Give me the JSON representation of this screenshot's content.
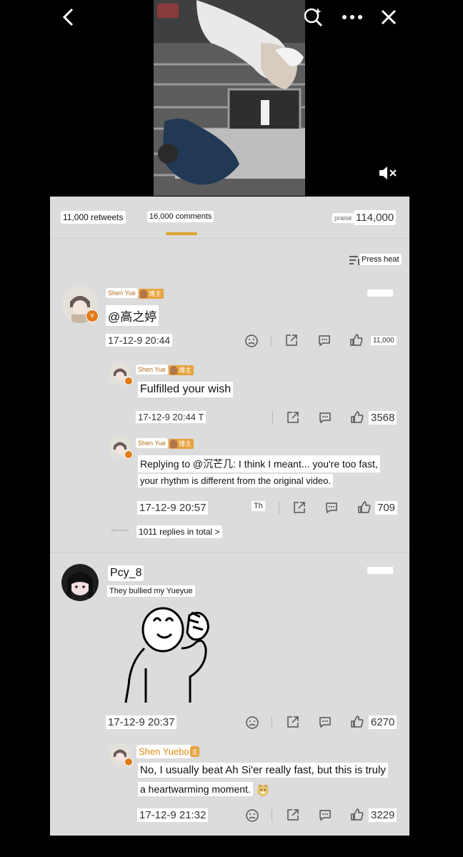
{
  "tabs": {
    "retweets": "11,000 retweets",
    "comments": "16,000 comments",
    "praise_label": "praise",
    "praise_count": "114,000"
  },
  "sort": {
    "label": "Press heat"
  },
  "comments": [
    {
      "author": "Shen Yue",
      "badge": "博主",
      "text": "@高之婷",
      "time": "17-12-9 20:44",
      "likes": "11,000",
      "replies": [
        {
          "author": "Shen Yue",
          "badge": "博主",
          "text": "Fulfilled your wish",
          "time": "17-12-9 20:44 T",
          "likes": "3568"
        },
        {
          "author": "Shen Yue",
          "badge": "博主",
          "text_line1": "Replying to @沉芒几: I think I meant... you're too fast,",
          "text_line2": "your rhythm is different from the original video.",
          "time": "17-12-9 20:57",
          "extra": "Th",
          "likes": "709"
        }
      ],
      "replies_total": "1011 replies in total >"
    },
    {
      "author": "Pcy_8",
      "text": "They bullied my Yueyue",
      "time": "17-12-9 20:37",
      "likes": "6270",
      "replies": [
        {
          "author": "Shen Yuebo",
          "badge": "主",
          "text_line1": "No, I usually beat Ah Si'er really fast, but this is truly",
          "text_line2": "a heartwarming moment.",
          "time": "17-12-9 21:32",
          "likes": "3229"
        }
      ]
    }
  ],
  "colors": {
    "accent": "#d9a531",
    "panel": "#dcdcdc",
    "badge": "#e7a23b"
  }
}
